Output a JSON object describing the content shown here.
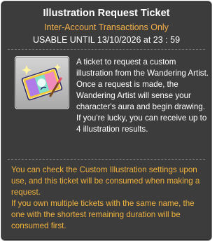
{
  "item": {
    "title": "Illustration Request Ticket",
    "trade_restriction": "Inter-Account Transactions Only",
    "usable_until": "USABLE UNTIL 13/10/2026 at 23 : 59",
    "icon": "illustration-ticket-icon",
    "description": [
      "A ticket to request a custom illustration from the Wandering Artist. Once a request is made, the Wandering Artist will sense your character's aura and begin drawing.",
      "If you're lucky, you can receive up to 4 illustration results."
    ],
    "notes": [
      "You can check the Custom Illustration settings upon use, and this ticket will be consumed when making a request.",
      "If you own multiple tickets with the same name, the one with the shortest remaining duration will be consumed first."
    ]
  },
  "colors": {
    "background": "#3c3c3c",
    "title": "#ffffff",
    "subtitle": "#f4b04a",
    "notes": "#f2b33d"
  }
}
